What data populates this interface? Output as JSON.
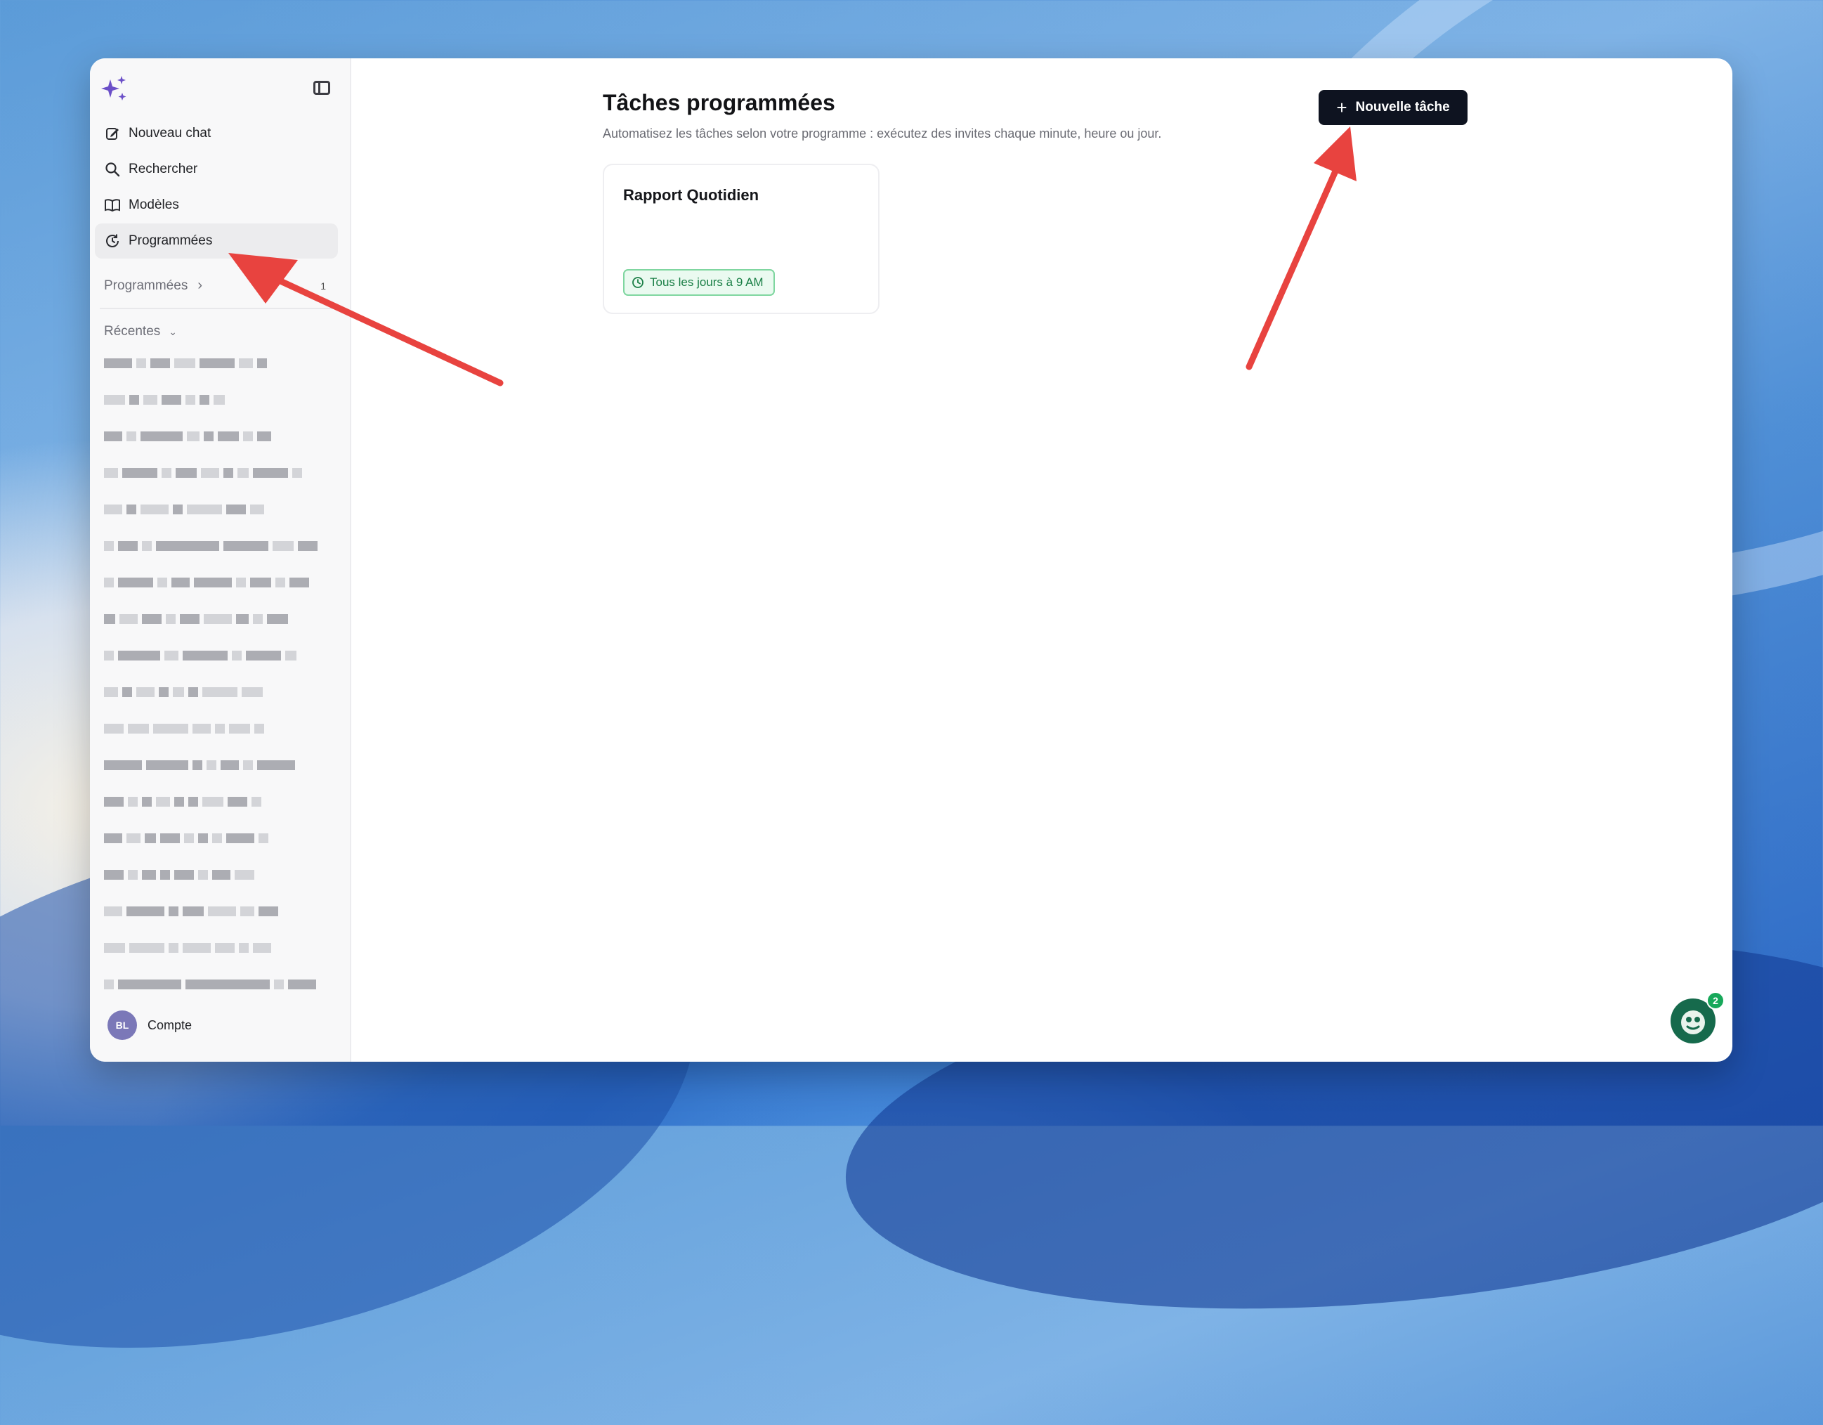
{
  "sidebar": {
    "items": [
      {
        "label": "Nouveau chat",
        "icon": "edit-icon"
      },
      {
        "label": "Rechercher",
        "icon": "search-icon"
      },
      {
        "label": "Modèles",
        "icon": "book-icon"
      },
      {
        "label": "Programmées",
        "icon": "clock-refresh-icon",
        "active": true
      }
    ],
    "scheduled_section": {
      "label": "Programmées",
      "count": "1"
    },
    "recent_section": {
      "label": "Récentes"
    },
    "account": {
      "initials": "BL",
      "label": "Compte"
    }
  },
  "main": {
    "title": "Tâches programmées",
    "subtitle": "Automatisez les tâches selon votre programme : exécutez des invites chaque minute, heure ou jour.",
    "new_task_button": "Nouvelle tâche",
    "tasks": [
      {
        "title": "Rapport Quotidien",
        "schedule": "Tous les jours à 9 AM"
      }
    ]
  },
  "help_widget": {
    "badge_count": "2"
  },
  "colors": {
    "accent": "#0e1320",
    "badge_green": "#1a7f46",
    "annotation_arrow": "#e8433f",
    "logo_purple": "#6b4fc8"
  }
}
